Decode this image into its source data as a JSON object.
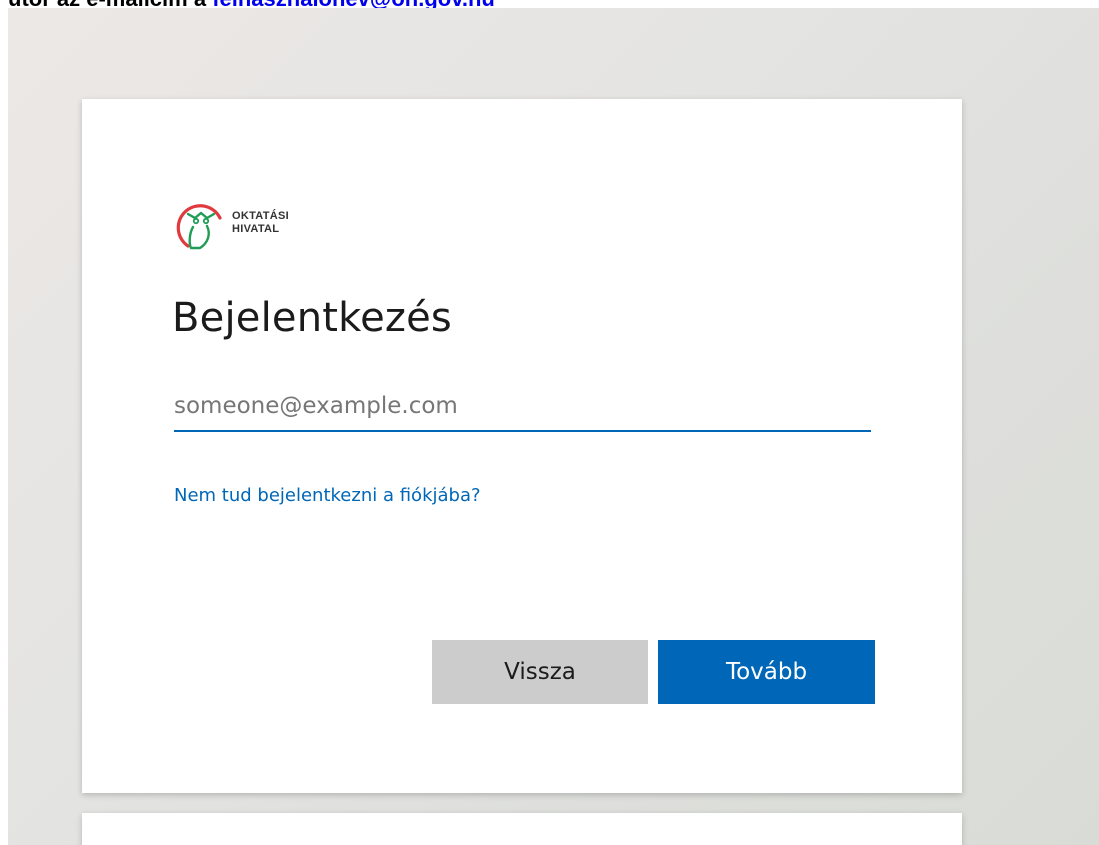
{
  "top_banner": {
    "prefix": "utor az e-mailcím a ",
    "link_text": "felhasznalonev@oh.gov.hu"
  },
  "logo": {
    "org_name": "OKTATÁSI\nHIVATAL",
    "icon": "owl-logo-icon"
  },
  "signin": {
    "title": "Bejelentkezés",
    "email_placeholder": "someone@example.com",
    "email_value": "",
    "forgot_link": "Nem tud bejelentkezni a fiókjába?",
    "back_label": "Vissza",
    "next_label": "Tovább"
  },
  "colors": {
    "accent": "#0067b8",
    "logo_red": "#e03a3e",
    "logo_green": "#1f9d55",
    "back_button": "#cccccc"
  }
}
